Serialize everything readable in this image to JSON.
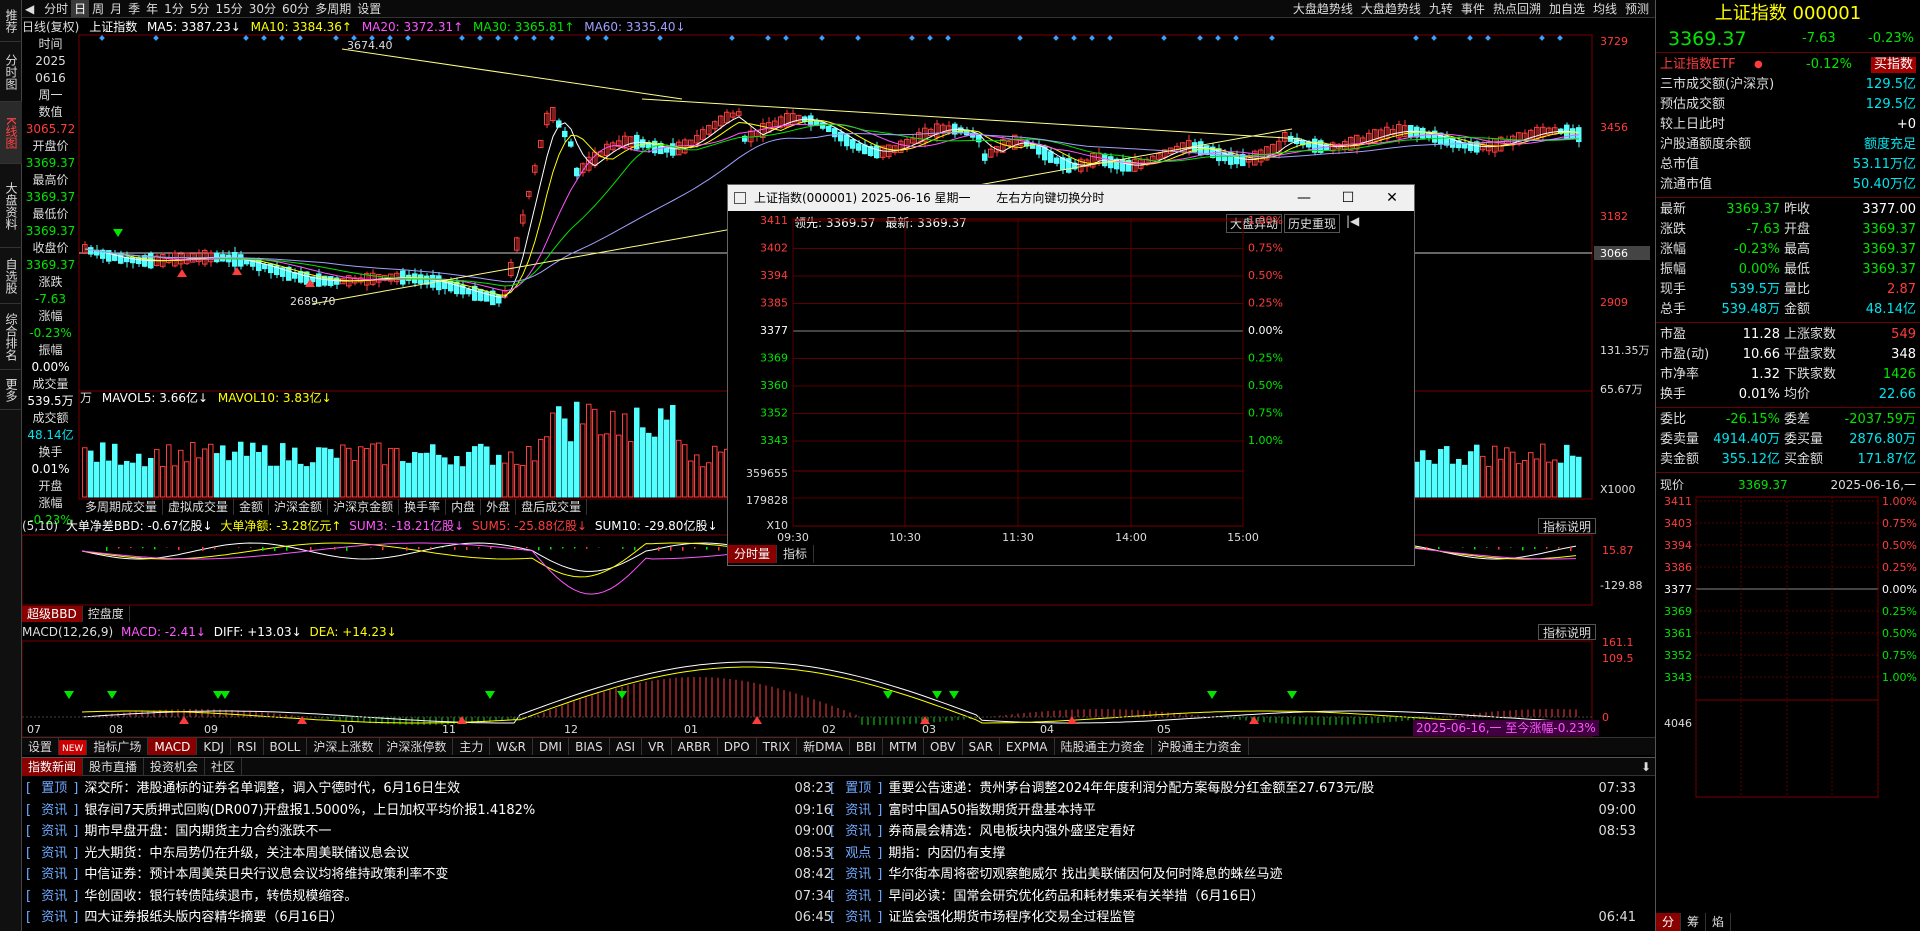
{
  "vtabs": [
    "推荐",
    "分时图",
    "K线图",
    "大盘资料",
    "自选股",
    "综合排名",
    "更多"
  ],
  "toolbar": {
    "items": [
      "分时",
      "日",
      "周",
      "月",
      "季",
      "年",
      "1分",
      "5分",
      "15分",
      "30分",
      "60分",
      "多周期",
      "设置"
    ],
    "active": 1,
    "right": [
      "大盘趋势线",
      "大盘趋势线",
      "九转",
      "事件",
      "热点回溯",
      "加自选",
      "均线",
      "预测"
    ]
  },
  "chart_title": {
    "label": "日线(复权)",
    "index": "上证指数",
    "ma5": "MA5: 3387.23↓",
    "ma10": "MA10: 3384.36↑",
    "ma20": "MA20: 3372.31↑",
    "ma30": "MA30: 3365.81↑",
    "ma60": "MA60: 3335.40↓"
  },
  "yaxis": [
    "3729",
    "3456",
    "3182",
    "3066",
    "2909"
  ],
  "annotations": {
    "high": "3674.40",
    "low": "2689.70"
  },
  "datapanel": [
    {
      "label": "时间"
    },
    {
      "label": "2025"
    },
    {
      "label": "0616"
    },
    {
      "label": "周一"
    },
    {
      "label": "数值"
    },
    {
      "val": "3065.72",
      "cls": "red"
    },
    {
      "label": "开盘价"
    },
    {
      "val": "3369.37",
      "cls": "green"
    },
    {
      "label": "最高价"
    },
    {
      "val": "3369.37",
      "cls": "green"
    },
    {
      "label": "最低价"
    },
    {
      "val": "3369.37",
      "cls": "green"
    },
    {
      "label": "收盘价"
    },
    {
      "val": "3369.37",
      "cls": "green"
    },
    {
      "label": "涨跌"
    },
    {
      "val": "-7.63",
      "cls": "green"
    },
    {
      "label": "涨幅"
    },
    {
      "val": "-0.23%",
      "cls": "green"
    },
    {
      "label": "振幅"
    },
    {
      "val": "0.00%",
      "cls": "white"
    },
    {
      "label": "成交量"
    },
    {
      "val": "539.5万",
      "cls": "white"
    },
    {
      "label": "成交额"
    },
    {
      "val": "48.14亿",
      "cls": "cyan"
    },
    {
      "label": "换手"
    },
    {
      "val": "0.01%",
      "cls": "white"
    },
    {
      "label": "开盘"
    },
    {
      "label": "涨幅"
    },
    {
      "val": "-0.23%",
      "cls": "green"
    }
  ],
  "volume": {
    "title_unit": "万",
    "mavol5": "MAVOL5: 3.66亿↓",
    "mavol10": "MAVOL10: 3.83亿↓",
    "y": [
      "131.35万",
      "65.67万",
      "X1000"
    ],
    "tabs": [
      "多周期成交量",
      "虚拟成交量",
      "金额",
      "沪深金额",
      "沪深京金额",
      "换手率",
      "内盘",
      "外盘",
      "盘后成交量"
    ]
  },
  "bbd": {
    "header": "(5,10)",
    "a": "大单净差BBD: -0.67亿股↓",
    "b": "大单净额: -3.28亿元↑",
    "c": "SUM3: -18.21亿股↓",
    "d": "SUM5: -25.88亿股↓",
    "e": "SUM10: -29.80亿股↓",
    "explain": "指标说明",
    "y": [
      "15.87",
      "-129.88"
    ],
    "tabs": [
      "超级BBD",
      "控盘度"
    ]
  },
  "macd": {
    "title": "MACD(12,26,9)",
    "macd": "MACD: -2.41↓",
    "diff": "DIFF: +13.03↓",
    "dea": "DEA: +14.23↓",
    "explain": "指标说明",
    "y": [
      "161.1",
      "109.5",
      "0"
    ],
    "months": [
      "07",
      "08",
      "09",
      "10",
      "11",
      "12",
      "01",
      "02",
      "03",
      "04",
      "05"
    ],
    "range": "2025-06-16,一 至今涨幅-0.23%"
  },
  "indtabs": [
    "设置",
    "NEW",
    "指标广场",
    "MACD",
    "KDJ",
    "RSI",
    "BOLL",
    "沪深上涨数",
    "沪深涨停数",
    "主力",
    "W&R",
    "DMI",
    "BIAS",
    "ASI",
    "VR",
    "ARBR",
    "DPO",
    "TRIX",
    "新DMA",
    "BBI",
    "MTM",
    "OBV",
    "SAR",
    "EXPMA",
    "陆股通主力资金",
    "沪股通主力资金"
  ],
  "popup": {
    "title": "上证指数(000001) 2025-06-16 星期一",
    "hint": "左右方向键切换分时",
    "lead": "领先: 3369.57",
    "latest": "最新: 3369.37",
    "btn1": "大盘异动",
    "btn2": "历史重现",
    "yl": [
      "3411",
      "3402",
      "3394",
      "3385",
      "3377",
      "3369",
      "3360",
      "3352",
      "3343"
    ],
    "yr": [
      "1.00%",
      "0.75%",
      "0.50%",
      "0.25%",
      "0.00%",
      "0.25%",
      "0.50%",
      "0.75%",
      "1.00%"
    ],
    "vol": [
      "359655",
      "179828",
      "X10"
    ],
    "times": [
      "09:30",
      "10:30",
      "11:30",
      "14:00",
      "15:00"
    ],
    "tabs": [
      "分时量",
      "指标"
    ]
  },
  "right": {
    "name": "上证指数 000001",
    "price": "3369.37",
    "chg": "-7.63",
    "pct": "-0.23%",
    "etf": "上证指数ETF",
    "etf_pct": "-0.12%",
    "etf_btn": "买指数",
    "rows1": [
      [
        "三市成交额(沪深京)",
        "129.5亿"
      ],
      [
        "预估成交额",
        "129.5亿"
      ],
      [
        "较上日此时",
        "+0"
      ],
      [
        "沪股通额度余额",
        "额度充足"
      ],
      [
        "总市值",
        "53.11万亿"
      ],
      [
        "流通市值",
        "50.40万亿"
      ]
    ],
    "rows2": [
      [
        "最新",
        "3369.37",
        "昨收",
        "3377.00"
      ],
      [
        "涨跌",
        "-7.63",
        "开盘",
        "3369.37"
      ],
      [
        "涨幅",
        "-0.23%",
        "最高",
        "3369.37"
      ],
      [
        "振幅",
        "0.00%",
        "最低",
        "3369.37"
      ],
      [
        "现手",
        "539.5万",
        "量比",
        "2.87"
      ],
      [
        "总手",
        "539.48万",
        "金额",
        "48.14亿"
      ]
    ],
    "rows3": [
      [
        "市盈",
        "11.28",
        "上涨家数",
        "549"
      ],
      [
        "市盈(动)",
        "10.66",
        "平盘家数",
        "348"
      ],
      [
        "市净率",
        "1.32",
        "下跌家数",
        "1426"
      ],
      [
        "换手",
        "0.01%",
        "均价",
        "22.66"
      ]
    ],
    "rows4": [
      [
        "委比",
        "-26.15%",
        "委差",
        "-2037.59万"
      ],
      [
        "委卖量",
        "4914.40万",
        "委买量",
        "2876.80万"
      ],
      [
        "卖金额",
        "355.12亿",
        "买金额",
        "171.87亿"
      ]
    ],
    "now": "现价",
    "now_val": "3369.37",
    "now_date": "2025-06-16,一",
    "mini_yl": [
      "3411",
      "3403",
      "3394",
      "3386",
      "3377",
      "3369",
      "3361",
      "3352",
      "3343",
      "4046"
    ],
    "mini_yr": [
      "1.00%",
      "0.75%",
      "0.50%",
      "0.25%",
      "0.00%",
      "0.25%",
      "0.50%",
      "0.75%",
      "1.00%"
    ],
    "bottom_tabs": [
      "分",
      "筹",
      "焰"
    ]
  },
  "news": {
    "tabs": [
      "指数新闻",
      "股市直播",
      "投资机会",
      "社区"
    ],
    "left": [
      [
        "置顶",
        "深交所：港股通标的证券名单调整，调入宁德时代，6月16日生效",
        "08:23"
      ],
      [
        "资讯",
        "银存间7天质押式回购(DR007)开盘报1.5000%，上日加权平均价报1.4182%",
        "09:16"
      ],
      [
        "资讯",
        "期市早盘开盘：国内期货主力合约涨跌不一",
        "09:00"
      ],
      [
        "资讯",
        "光大期货：中东局势仍在升级，关注本周美联储议息会议",
        "08:53"
      ],
      [
        "资讯",
        "中信证券：预计本周美英日央行议息会议均将维持政策利率不变",
        "08:42"
      ],
      [
        "资讯",
        "华创固收：银行转债陆续退市，转债规模缩容。",
        "07:34"
      ],
      [
        "资讯",
        "四大证券报纸头版内容精华摘要（6月16日）",
        "06:45"
      ]
    ],
    "right": [
      [
        "置顶",
        "重要公告速递：贵州茅台调整2024年年度利润分配方案每股分红金额至27.673元/股",
        "07:33"
      ],
      [
        "资讯",
        "富时中国A50指数期货开盘基本持平",
        "09:00"
      ],
      [
        "资讯",
        "券商晨会精选：风电板块内强外盛坚定看好",
        "08:53"
      ],
      [
        "观点",
        "期指：内因仍有支撑",
        ""
      ],
      [
        "资讯",
        "华尔街本周将密切观察鲍威尔 找出美联储因何及何时降息的蛛丝马迹",
        ""
      ],
      [
        "资讯",
        "早间必读：国常会研究优化药品和耗材集采有关举措（6月16日）",
        ""
      ],
      [
        "资讯",
        "证监会强化期货市场程序化交易全过程监管",
        "06:41"
      ]
    ]
  }
}
